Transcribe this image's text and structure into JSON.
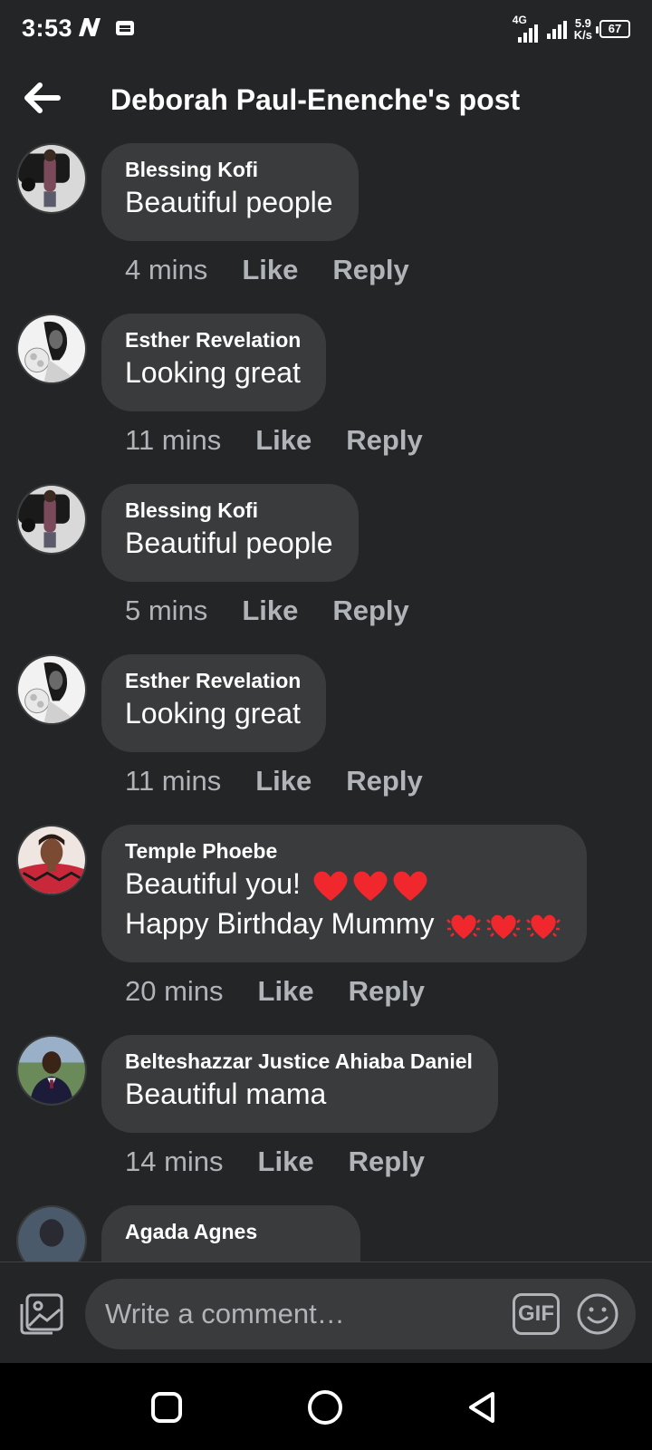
{
  "status_bar": {
    "time": "3:53",
    "network": "4G",
    "speed_value": "5.9",
    "speed_unit": "K/s",
    "battery": "67"
  },
  "header": {
    "title": "Deborah Paul-Enenche's post",
    "back_icon": "arrow-left-icon"
  },
  "comments": [
    {
      "author": "Blessing Kofi",
      "text": "Beautiful people",
      "time": "4 mins",
      "like": "Like",
      "reply": "Reply"
    },
    {
      "author": "Esther Revelation",
      "text": "Looking great",
      "time": "11 mins",
      "like": "Like",
      "reply": "Reply"
    },
    {
      "author": "Blessing Kofi",
      "text": "Beautiful people",
      "time": "5 mins",
      "like": "Like",
      "reply": "Reply"
    },
    {
      "author": "Esther Revelation",
      "text": "Looking great",
      "time": "11 mins",
      "like": "Like",
      "reply": "Reply"
    },
    {
      "author": "Temple Phoebe",
      "text": "Beautiful you!",
      "text2": "Happy Birthday Mummy",
      "time": "20 mins",
      "like": "Like",
      "reply": "Reply"
    },
    {
      "author": "Belteshazzar Justice Ahiaba Daniel",
      "text": "Beautiful mama",
      "time": "14 mins",
      "like": "Like",
      "reply": "Reply"
    },
    {
      "author": "Agada Agnes"
    }
  ],
  "composer": {
    "placeholder": "Write a comment…",
    "gif_label": "GIF",
    "photo_icon": "photo-icon",
    "emoji_icon": "emoji-icon"
  },
  "navbar": {
    "icons": [
      "recents-icon",
      "home-icon",
      "back-icon"
    ]
  },
  "colors": {
    "background": "#242526",
    "bubble": "#3a3b3c",
    "secondary_text": "#b0b3b8",
    "heart": "#f0282d"
  }
}
